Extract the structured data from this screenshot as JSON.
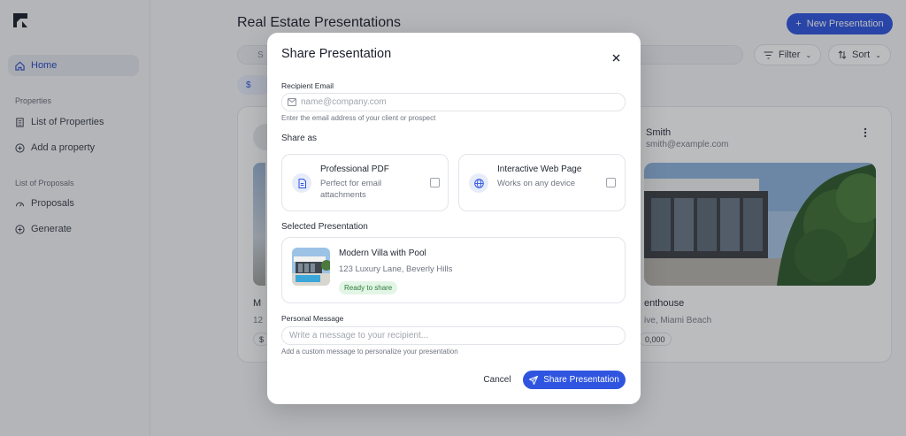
{
  "sidebar": {
    "home": "Home",
    "section_properties": "Properties",
    "list_properties": "List of Properties",
    "add_property": "Add a property",
    "section_proposals": "List of Proposals",
    "proposals": "Proposals",
    "generate": "Generate"
  },
  "header": {
    "title": "Real Estate Presentations",
    "new_button": "New Presentation"
  },
  "toolbar": {
    "search_placeholder": "S",
    "filter": "Filter",
    "sort": "Sort",
    "chip": "$"
  },
  "background_cards": {
    "left_title": "M",
    "left_sub": "12",
    "left_price": "$",
    "agent_name": "Smith",
    "agent_email": "smith@example.com",
    "right_title": "enthouse",
    "right_addr": "ive, Miami Beach",
    "right_price": "0,000"
  },
  "modal": {
    "title": "Share Presentation",
    "close_icon": "close-icon",
    "recipient_label": "Recipient Email",
    "email_placeholder": "name@company.com",
    "email_value": "",
    "email_help": "Enter the email address of your client or prospect",
    "share_as_label": "Share as",
    "options": [
      {
        "title": "Professional PDF",
        "desc": "Perfect for email attachments",
        "icon": "document-icon",
        "checked": false
      },
      {
        "title": "Interactive Web Page",
        "desc": "Works on any device",
        "icon": "globe-icon",
        "checked": false
      }
    ],
    "selected_label": "Selected Presentation",
    "selected": {
      "title": "Modern Villa with Pool",
      "address": "123 Luxury Lane, Beverly Hills",
      "status": "Ready to share"
    },
    "message_label": "Personal Message",
    "message_placeholder": "Write a message to your recipient...",
    "message_help": "Add a custom message to personalize your presentation",
    "cancel": "Cancel",
    "share": "Share Presentation"
  },
  "colors": {
    "accent": "#2f55e0",
    "ready_bg": "#e3f5e6",
    "ready_text": "#2e7d3a"
  }
}
